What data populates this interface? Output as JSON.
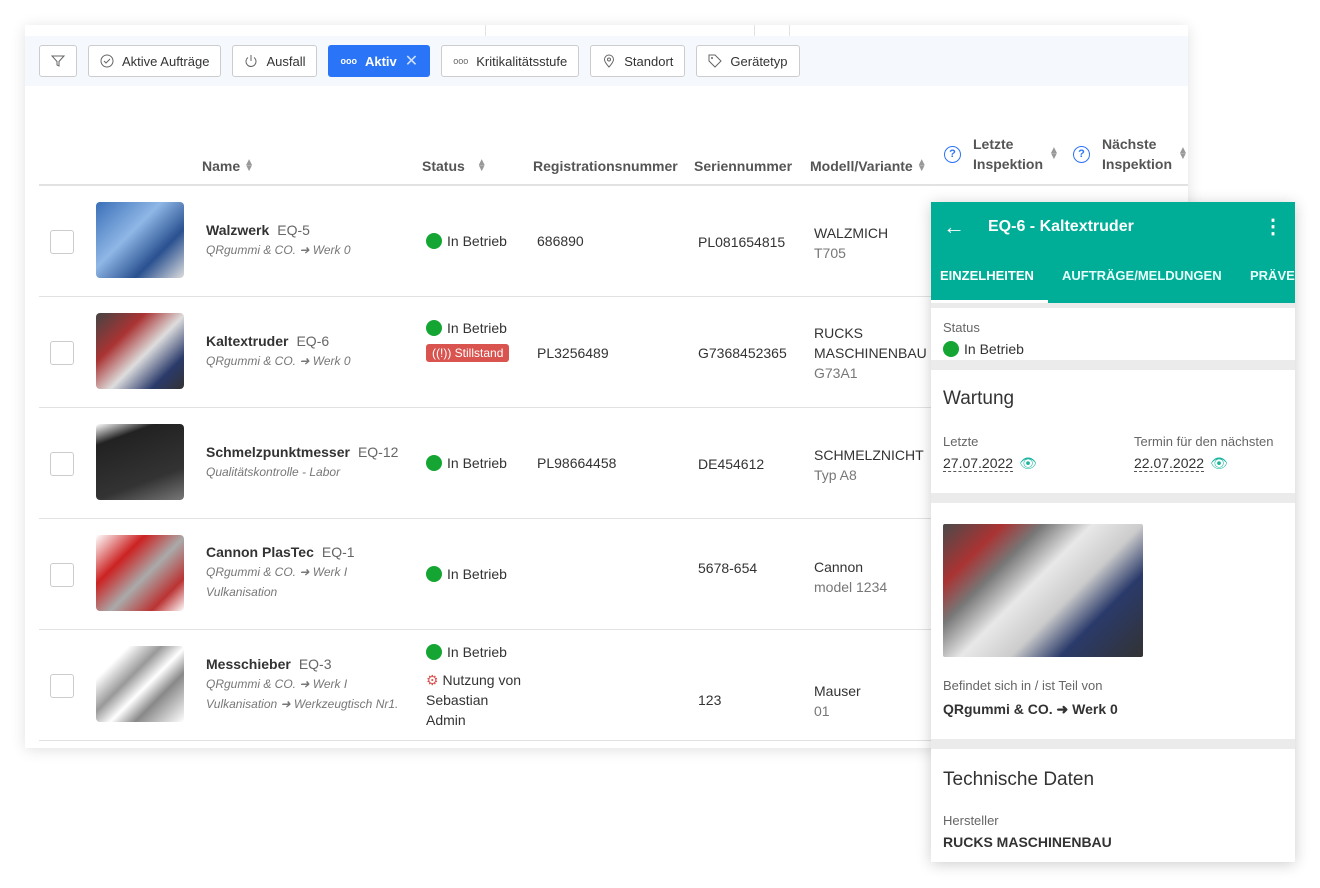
{
  "filters": [
    {
      "label": "",
      "icon": "filter-icon"
    },
    {
      "label": "Aktive Aufträge",
      "icon": "check-circle-icon"
    },
    {
      "label": "Ausfall",
      "icon": "power-icon"
    },
    {
      "label": "Aktiv",
      "icon": "dots-icon",
      "active": true
    },
    {
      "label": "Kritikalitätsstufe",
      "icon": "dots-icon"
    },
    {
      "label": "Standort",
      "icon": "location-pin-icon"
    },
    {
      "label": "Gerätetyp",
      "icon": "tag-icon"
    }
  ],
  "columns": {
    "name": "Name",
    "status": "Status",
    "reg": "Registrationsnummer",
    "serial": "Seriennummer",
    "model": "Modell/Variante",
    "last": "Letzte Inspektion",
    "next": "Nächste Inspektion"
  },
  "rows": [
    {
      "name": "Walzwerk",
      "eq": "EQ-5",
      "loc": "QRgummi & CO. ➜ Werk 0",
      "status": "In Betrieb",
      "reg": "686890",
      "serial": "PL081654815",
      "model": "WALZMICH",
      "variant": "T705"
    },
    {
      "name": "Kaltextruder",
      "eq": "EQ-6",
      "loc": "QRgummi & CO. ➜ Werk 0",
      "status": "In Betrieb",
      "badge": "Stillstand",
      "reg": "PL3256489",
      "serial": "G7368452365",
      "model": "RUCKS MASCHINENBAU",
      "variant": "G73A1"
    },
    {
      "name": "Schmelzpunktmesser",
      "eq": "EQ-12",
      "loc": "Qualitätskontrolle - Labor",
      "status": "In Betrieb",
      "reg": "PL98664458",
      "serial": "DE454612",
      "model": "SCHMELZNICHT",
      "variant": "Typ A8"
    },
    {
      "name": "Cannon PlasTec",
      "eq": "EQ-1",
      "loc": "QRgummi & CO. ➜ Werk I Vulkanisation",
      "status": "In Betrieb",
      "reg": "",
      "serial": "5678-654",
      "model": "Cannon",
      "variant": "model 1234"
    },
    {
      "name": "Messchieber",
      "eq": "EQ-3",
      "loc": "QRgummi & CO. ➜ Werk I Vulkanisation ➜ Werkzeugtisch Nr1.",
      "status": "In Betrieb",
      "usage": "Nutzung von Sebastian Admin",
      "reg": "",
      "serial": "123",
      "model": "Mauser",
      "variant": "01"
    }
  ],
  "panel": {
    "title": "EQ-6 - Kaltextruder",
    "tabs": [
      "EINZELHEITEN",
      "AUFTRÄGE/MELDUNGEN",
      "PRÄVE"
    ],
    "status_label": "Status",
    "status": "In Betrieb",
    "wartung": "Wartung",
    "last_label": "Letzte",
    "last_date": "27.07.2022",
    "next_label": "Termin für den nächsten",
    "next_date": "22.07.2022",
    "location_label": "Befindet sich in / ist Teil von",
    "location": "QRgummi & CO. ➜ Werk 0",
    "tech": "Technische Daten",
    "maker_label": "Hersteller",
    "maker": "RUCKS MASCHINENBAU"
  },
  "colors": {
    "accent": "#2a74f7",
    "teal": "#00ad96",
    "ok": "#15a533",
    "alert": "#d9534f"
  }
}
